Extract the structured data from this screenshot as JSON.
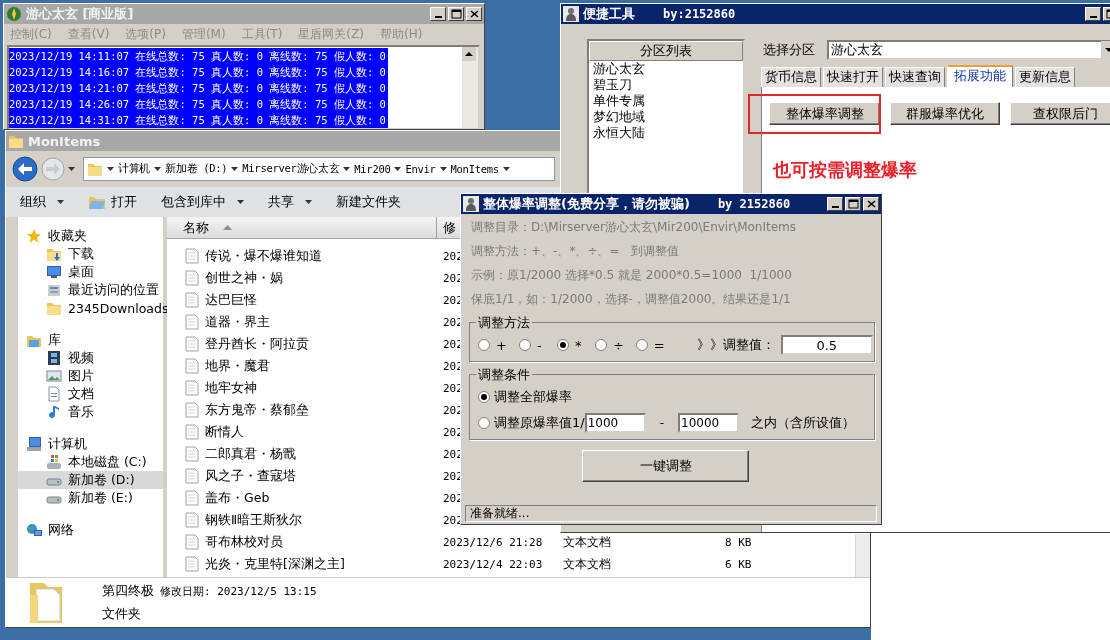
{
  "server_window": {
    "title": "游心太玄 [商业版]",
    "active": false,
    "menu": [
      "控制(C)",
      "查看(V)",
      "选项(P)",
      "管理(M)",
      "工具(T)",
      "星盾网关(Z)",
      "帮助(H)"
    ],
    "log": [
      {
        "text": "2023/12/19 14:11:07 在线总数: 75 真人数: 0 离线数: 75 假人数: 0",
        "selected": true
      },
      {
        "text": "2023/12/19 14:16:07 在线总数: 75 真人数: 0 离线数: 75 假人数: 0",
        "selected": true
      },
      {
        "text": "2023/12/19 14:21:07 在线总数: 75 真人数: 0 离线数: 75 假人数: 0",
        "selected": true
      },
      {
        "text": "2023/12/19 14:26:07 在线总数: 75 真人数: 0 离线数: 75 假人数: 0",
        "selected": true
      },
      {
        "text": "2023/12/19 14:31:07 在线总数: 75 真人数: 0 离线数: 75 假人数: 0",
        "selected": true
      }
    ]
  },
  "explorer": {
    "title": "MonItems",
    "active": false,
    "path": [
      "计算机",
      "新加卷 (D:)",
      "Mirserver游心太玄",
      "Mir200",
      "Envir",
      "MonItems"
    ],
    "toolbar": [
      {
        "label": "组织",
        "dropdown": true,
        "icon": false
      },
      {
        "label": "打开",
        "dropdown": false,
        "icon": true
      },
      {
        "label": "包含到库中",
        "dropdown": true,
        "icon": false
      },
      {
        "label": "共享",
        "dropdown": true,
        "icon": false
      },
      {
        "label": "新建文件夹",
        "dropdown": false,
        "icon": false
      }
    ],
    "nav": [
      {
        "label": "收藏夹",
        "kind": "favorites",
        "selected": false,
        "children": [
          {
            "label": "下载",
            "kind": "downloads",
            "selected": false
          },
          {
            "label": "桌面",
            "kind": "desktop",
            "selected": false
          },
          {
            "label": "最近访问的位置",
            "kind": "recent",
            "selected": false
          },
          {
            "label": "2345Downloads",
            "kind": "folder",
            "selected": false
          }
        ]
      },
      {
        "label": "库",
        "kind": "library",
        "selected": false,
        "children": [
          {
            "label": "视频",
            "kind": "video",
            "selected": false
          },
          {
            "label": "图片",
            "kind": "pictures",
            "selected": false
          },
          {
            "label": "文档",
            "kind": "documents",
            "selected": false
          },
          {
            "label": "音乐",
            "kind": "music",
            "selected": false
          }
        ]
      },
      {
        "label": "计算机",
        "kind": "computer",
        "selected": false,
        "children": [
          {
            "label": "本地磁盘 (C:)",
            "kind": "system_drive",
            "selected": false
          },
          {
            "label": "新加卷 (D:)",
            "kind": "drive",
            "selected": true
          },
          {
            "label": "新加卷 (E:)",
            "kind": "drive",
            "selected": false
          }
        ]
      },
      {
        "label": "网络",
        "kind": "network",
        "selected": false
      }
    ],
    "columns": [
      {
        "label": "名称",
        "sorted": true
      },
      {
        "label": "修",
        "sorted": false
      }
    ],
    "rows": [
      {
        "name": "传说・爆不爆谁知道",
        "date": "202"
      },
      {
        "name": "创世之神・娲",
        "date": "202"
      },
      {
        "name": "达巴巨怪",
        "date": "202"
      },
      {
        "name": "道器・界主",
        "date": "202"
      },
      {
        "name": "登丹酋长・阿拉贡",
        "date": "202"
      },
      {
        "name": "地界・魔君",
        "date": "202"
      },
      {
        "name": "地牢女神",
        "date": "202"
      },
      {
        "name": "东方鬼帝・蔡郁垒",
        "date": "202"
      },
      {
        "name": "断情人",
        "date": "202"
      },
      {
        "name": "二郎真君・杨戬",
        "date": "202"
      },
      {
        "name": "风之子・查寇塔",
        "date": "202"
      },
      {
        "name": "盖布・Geb",
        "date": "202"
      },
      {
        "name": "钢铁Ⅱ暗王斯狄尔",
        "date": "202"
      },
      {
        "name": "哥布林校对员",
        "date": "2023/12/6 21:28",
        "type": "文本文档",
        "size": "8 KB"
      },
      {
        "name": "光炎・克里特[深渊之主]",
        "date": "2023/12/4 22:03",
        "type": "文本文档",
        "size": "6 KB"
      }
    ],
    "details": {
      "name": "第四终极",
      "modified": "修改日期: 2023/12/5 13:15",
      "type": "文件夹"
    }
  },
  "tool_window": {
    "title": "便捷工具",
    "subtitle": "by:2152860",
    "active": true,
    "list_header": "分区列表",
    "list": [
      "游心太玄",
      "碧玉刀",
      "单件专属",
      "梦幻地域",
      "永恒大陆"
    ],
    "zone_label": "选择分区",
    "zone_value": "游心太玄",
    "tabs": [
      {
        "label": "货币信息",
        "selected": false
      },
      {
        "label": "快速打开",
        "selected": false
      },
      {
        "label": "快速查询",
        "selected": false
      },
      {
        "label": "拓展功能",
        "selected": true
      },
      {
        "label": "更新信息",
        "selected": false
      }
    ],
    "buttons": [
      {
        "label": "整体爆率调整",
        "highlighted": true
      },
      {
        "label": "群服爆率优化",
        "highlighted": false
      },
      {
        "label": "查权限后门",
        "highlighted": false
      }
    ],
    "annotation": "也可按需调整爆率"
  },
  "dialog": {
    "title": "整体爆率调整(免费分享，请勿被骗)",
    "subtitle": "by 2152860",
    "active": true,
    "info": [
      "调整目录：D:\\Mirserver游心太玄\\Mir200\\Envir\\MonItems",
      "调整方法：+、-、*、÷、=   到调整值",
      "示例：原1/2000 选择*0.5 就是 2000*0.5=1000  1/1000",
      "保底1/1，如：1/2000，选择-，调整值2000。结果还是1/1"
    ],
    "method_group": "调整方法",
    "methods": [
      {
        "label": "+",
        "selected": false
      },
      {
        "label": "-",
        "selected": false
      },
      {
        "label": "*",
        "selected": true
      },
      {
        "label": "÷",
        "selected": false
      },
      {
        "label": "=",
        "selected": false
      }
    ],
    "value_label": "》》调整值：",
    "value": "0.5",
    "condition_group": "调整条件",
    "conditions": [
      {
        "kind": "all",
        "label": "调整全部爆率",
        "selected": true
      },
      {
        "kind": "range",
        "label": "调整原爆率值1/",
        "min": "1000",
        "separator": "-",
        "max": "10000",
        "suffix": "之内（含所设值）",
        "selected": false
      }
    ],
    "button": "一键调整",
    "status": "准备就绪..."
  }
}
